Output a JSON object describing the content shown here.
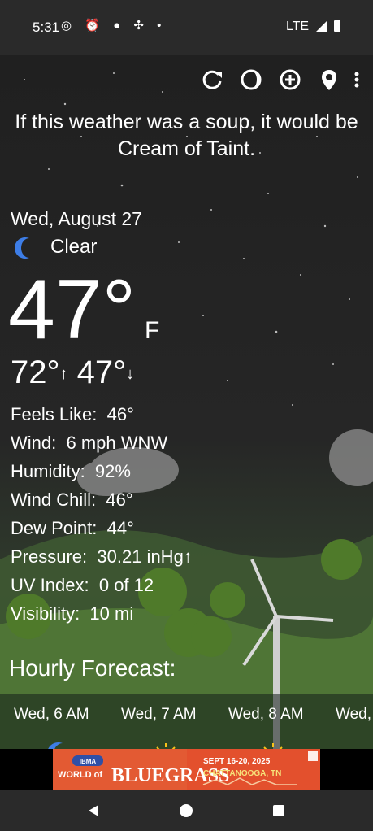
{
  "status_bar": {
    "time": "5:31",
    "network": "LTE"
  },
  "toolbar": {
    "icons": [
      "refresh-icon",
      "moon-phase-icon",
      "add-location-icon",
      "location-pin-icon",
      "more-icon"
    ]
  },
  "quote": "If this weather was a soup, it would be Cream of Taint.",
  "current": {
    "date": "Wed, August 27",
    "condition": "Clear",
    "condition_icon": "moon-icon",
    "temperature": "47°",
    "unit": "F",
    "high": "72°",
    "high_arrow": "↑",
    "low": "47°",
    "low_arrow": "↓"
  },
  "details": [
    {
      "label": "Feels Like:",
      "value": "46°"
    },
    {
      "label": "Wind:",
      "value": "6 mph WNW"
    },
    {
      "label": "Humidity:",
      "value": "92%"
    },
    {
      "label": "Wind Chill:",
      "value": "46°"
    },
    {
      "label": "Dew Point:",
      "value": "44°"
    },
    {
      "label": "Pressure:",
      "value": "30.21 inHg↑"
    },
    {
      "label": "UV Index:",
      "value": "0 of 12"
    },
    {
      "label": "Visibility:",
      "value": "10 mi"
    }
  ],
  "hourly": {
    "title": "Hourly Forecast:",
    "items": [
      {
        "label": "Wed, 6 AM",
        "icon": "moon-icon"
      },
      {
        "label": "Wed, 7 AM",
        "icon": "sun-icon"
      },
      {
        "label": "Wed, 8 AM",
        "icon": "sun-icon"
      },
      {
        "label": "Wed,",
        "icon": "sun-icon"
      }
    ]
  },
  "ad": {
    "brand_top": "IBMA",
    "brand_bottom": "WORLD of",
    "headline": "BLUEGRASS",
    "dates": "SEPT 16-20, 2025",
    "city": "CHATTANOOGA, TN",
    "colors": {
      "background": "#e3502d",
      "accent": "#2f4fa6"
    }
  },
  "nav": {
    "icons": [
      "back-icon",
      "home-icon",
      "recents-icon"
    ]
  }
}
